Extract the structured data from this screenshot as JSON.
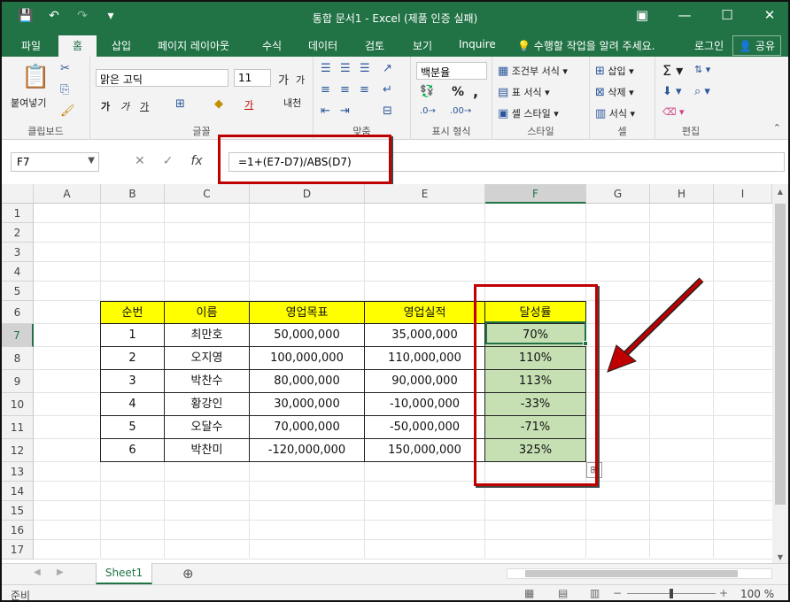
{
  "window": {
    "title": "통합 문서1 - Excel (제품 인증 실패)",
    "qat": {
      "save": "💾",
      "undo": "↶",
      "redo": "↷",
      "customize": "▾"
    },
    "controls": {
      "restore": "▣",
      "minimize": "—",
      "maximize": "☐",
      "close": "✕"
    }
  },
  "tabs": [
    "파일",
    "홈",
    "삽입",
    "페이지 레이아웃",
    "수식",
    "데이터",
    "검토",
    "보기",
    "Inquire"
  ],
  "tell_me": "수행할 작업을 알려 주세요.",
  "account": {
    "signin": "로그인",
    "share": "공유"
  },
  "ribbon": {
    "clipboard": {
      "paste": "붙여넣기",
      "label": "클립보드"
    },
    "font": {
      "name": "맑은 고딕",
      "size": "11",
      "grow": "가",
      "shrink": "가",
      "bold": "가",
      "italic": "가",
      "underline": "가",
      "color": "가",
      "phonetic": "내천",
      "label": "글꼴"
    },
    "alignment": {
      "label": "맞춤"
    },
    "number": {
      "format": "백분율",
      "percent": "%",
      "comma": ",",
      "label": "표시 형식"
    },
    "styles": {
      "conditional": "조건부 서식",
      "table": "표 서식",
      "cell": "셀 스타일",
      "label": "스타일"
    },
    "cells": {
      "insert": "삽입",
      "delete": "삭제",
      "format": "서식",
      "label": "셀"
    },
    "editing": {
      "label": "편집"
    }
  },
  "formula_bar": {
    "name_box": "F7",
    "cancel": "✕",
    "enter": "✓",
    "fx": "fx",
    "formula": "=1+(E7-D7)/ABS(D7)"
  },
  "columns": [
    "A",
    "B",
    "C",
    "D",
    "E",
    "F",
    "G",
    "H",
    "I"
  ],
  "rows": [
    "1",
    "2",
    "3",
    "4",
    "5",
    "6",
    "7",
    "8",
    "9",
    "10",
    "11",
    "12",
    "13",
    "14",
    "15",
    "16",
    "17"
  ],
  "table": {
    "headers": [
      "순번",
      "이름",
      "영업목표",
      "영업실적",
      "달성률"
    ],
    "rows": [
      [
        "1",
        "최만호",
        "50,000,000",
        "35,000,000",
        "70%"
      ],
      [
        "2",
        "오지영",
        "100,000,000",
        "110,000,000",
        "110%"
      ],
      [
        "3",
        "박찬수",
        "80,000,000",
        "90,000,000",
        "113%"
      ],
      [
        "4",
        "황강인",
        "30,000,000",
        "-10,000,000",
        "-33%"
      ],
      [
        "5",
        "오달수",
        "70,000,000",
        "-50,000,000",
        "-71%"
      ],
      [
        "6",
        "박찬미",
        "-120,000,000",
        "150,000,000",
        "325%"
      ]
    ]
  },
  "sheet": {
    "tab": "Sheet1",
    "add": "⊕"
  },
  "status": {
    "ready": "준비",
    "zoom": "100 %"
  },
  "colors": {
    "excel_green": "#217346",
    "header_fill": "#ffff00",
    "result_fill": "#c6e0b4",
    "annotation_red": "#c00000"
  }
}
